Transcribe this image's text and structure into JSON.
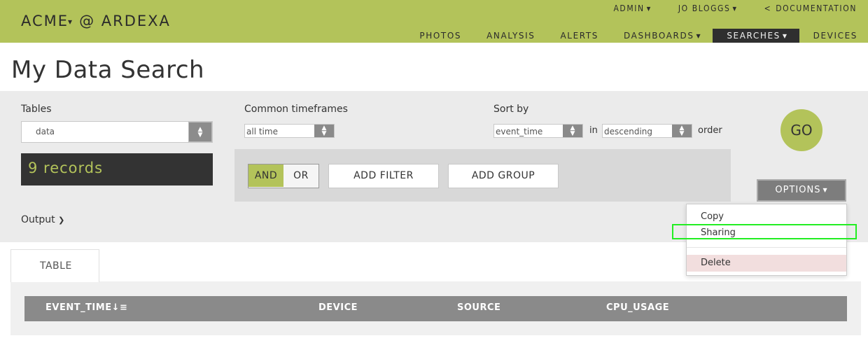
{
  "brand": {
    "logo_text": "ACME",
    "logo_suffix": "@ ARDEXA"
  },
  "nav_upper": [
    {
      "label": "ADMIN",
      "caret": true
    },
    {
      "label": "JO BLOGGS",
      "caret": true
    },
    {
      "label": "DOCUMENTATION",
      "back": true
    }
  ],
  "nav_lower": [
    {
      "label": "PHOTOS"
    },
    {
      "label": "ANALYSIS"
    },
    {
      "label": "ALERTS"
    },
    {
      "label": "DASHBOARDS",
      "caret": true
    },
    {
      "label": "SEARCHES",
      "caret": true,
      "active": true
    },
    {
      "label": "DEVICES"
    }
  ],
  "page_title": "My Data Search",
  "tables": {
    "label": "Tables",
    "value": "data"
  },
  "timeframes": {
    "label": "Common timeframes",
    "value": "all time"
  },
  "sort": {
    "label": "Sort by",
    "field": "event_time",
    "in": "in",
    "direction": "descending",
    "order": "order"
  },
  "records": "9 records",
  "filters": {
    "and": "AND",
    "or": "OR",
    "add_filter": "ADD FILTER",
    "add_group": "ADD GROUP"
  },
  "go": "GO",
  "options": "OPTIONS",
  "output": "Output",
  "menu": {
    "copy": "Copy",
    "sharing": "Sharing",
    "delete": "Delete"
  },
  "tab": "TABLE",
  "columns": [
    "EVENT_TIME",
    "DEVICE",
    "SOURCE",
    "CPU_USAGE"
  ],
  "colors": {
    "accent": "#b3c35a",
    "dark": "#333333",
    "panel": "#ebebeb",
    "highlight": "#22ee22"
  }
}
